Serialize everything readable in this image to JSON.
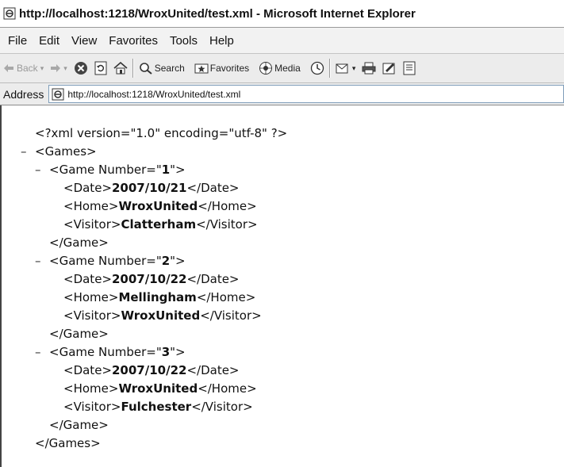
{
  "window": {
    "title": "http://localhost:1218/WroxUnited/test.xml - Microsoft Internet Explorer"
  },
  "menu": [
    "File",
    "Edit",
    "View",
    "Favorites",
    "Tools",
    "Help"
  ],
  "toolbar": {
    "back_label": "Back",
    "search_label": "Search",
    "favorites_label": "Favorites",
    "media_label": "Media"
  },
  "address": {
    "label": "Address",
    "url": "http://localhost:1218/WroxUnited/test.xml"
  },
  "xml": {
    "declaration": "<?xml version=\"1.0\" encoding=\"utf-8\" ?>",
    "minus": "–",
    "root_open": "<Games>",
    "root_close": "</Games>",
    "game_open_prefix": "<Game Number=\"",
    "game_open_suffix": "\">",
    "game_close": "</Game>",
    "date_open": "<Date>",
    "date_close": "</Date>",
    "home_open": "<Home>",
    "home_close": "</Home>",
    "visitor_open": "<Visitor>",
    "visitor_close": "</Visitor>",
    "games": [
      {
        "number": "1",
        "date": "2007/10/21",
        "home": "WroxUnited",
        "visitor": "Clatterham"
      },
      {
        "number": "2",
        "date": "2007/10/22",
        "home": "Mellingham",
        "visitor": "WroxUnited"
      },
      {
        "number": "3",
        "date": "2007/10/22",
        "home": "WroxUnited",
        "visitor": "Fulchester"
      }
    ]
  }
}
